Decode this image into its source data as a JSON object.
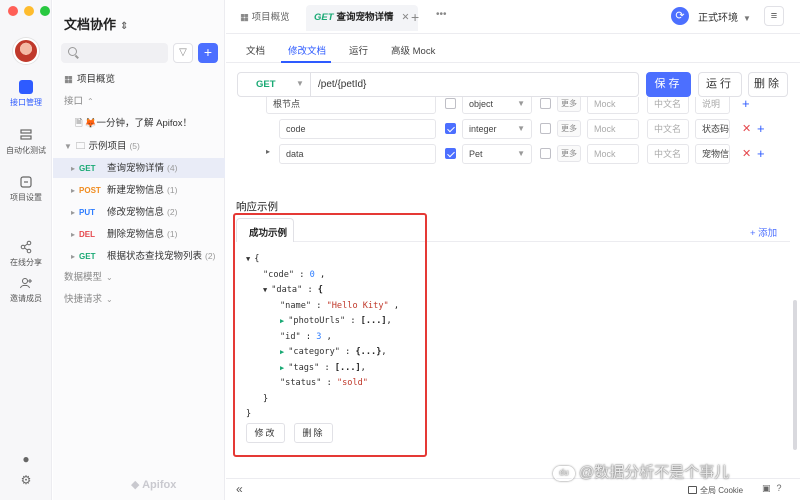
{
  "app": {
    "brand": "Apifox",
    "project_name": "文档协作"
  },
  "rail": {
    "items": [
      {
        "label": "接口管理",
        "active": true,
        "icon": "api-icon"
      },
      {
        "label": "自动化测试",
        "active": false,
        "icon": "automation-icon"
      },
      {
        "label": "项目设置",
        "active": false,
        "icon": "settings-icon"
      },
      {
        "label": "在线分享",
        "active": false,
        "icon": "share-icon"
      },
      {
        "label": "邀请成员",
        "active": false,
        "icon": "invite-icon"
      }
    ]
  },
  "sidebar": {
    "overview": "项目概览",
    "section_api": "接口",
    "intro_doc": "🦊一分钟，了解 Apifox！",
    "folder": {
      "label": "示例项目",
      "count": "(5)"
    },
    "apis": [
      {
        "method": "GET",
        "name": "查询宠物详情",
        "count": "(4)",
        "active": true
      },
      {
        "method": "POST",
        "name": "新建宠物信息",
        "count": "(1)",
        "active": false
      },
      {
        "method": "PUT",
        "name": "修改宠物信息",
        "count": "(2)",
        "active": false
      },
      {
        "method": "DEL",
        "name": "删除宠物信息",
        "count": "(1)",
        "active": false
      },
      {
        "method": "GET",
        "name": "根据状态查找宠物列表",
        "count": "(2)",
        "active": false
      }
    ],
    "section_models": "数据模型",
    "section_quick": "快捷请求"
  },
  "topbar": {
    "tab_overview": "项目概览",
    "tab_active_method": "GET",
    "tab_active_name": "查询宠物详情",
    "environment": "正式环境"
  },
  "subtabs": [
    "文档",
    "修改文档",
    "运行",
    "高级 Mock"
  ],
  "request": {
    "method": "GET",
    "path": "/pet/{petId}",
    "save": "保存",
    "run": "运行",
    "delete": "删除"
  },
  "schema_rows": [
    {
      "name": "根节点",
      "checked": false,
      "type": "object",
      "more": "更多",
      "mock": "Mock",
      "cn": "中文名",
      "desc": "说明",
      "has_x": false
    },
    {
      "name": "code",
      "checked": true,
      "type": "integer",
      "more": "更多",
      "mock": "Mock",
      "cn": "中文名",
      "desc": "状态码",
      "has_x": true
    },
    {
      "name": "data",
      "checked": true,
      "type": "Pet",
      "more": "更多",
      "mock": "Mock",
      "cn": "中文名",
      "desc": "宠物信",
      "has_x": true
    }
  ],
  "response": {
    "title": "响应示例",
    "tab": "成功示例",
    "add": "+ 添加",
    "edit": "修改",
    "delete": "删除",
    "json_lines": [
      {
        "indent": 0,
        "tri": "open",
        "text": "{"
      },
      {
        "indent": 1,
        "key": "\"code\"",
        "sep": " : ",
        "val": "0",
        "vtype": "num",
        "tail": " ,"
      },
      {
        "indent": 1,
        "tri": "open",
        "key": "\"data\"",
        "sep": " : ",
        "val": "{",
        "vtype": "plain",
        "tail": ""
      },
      {
        "indent": 2,
        "key": "\"name\"",
        "sep": " : ",
        "val": "\"Hello Kity\"",
        "vtype": "str",
        "tail": " ,"
      },
      {
        "indent": 2,
        "tri": "closed",
        "key": "\"photoUrls\"",
        "sep": " : ",
        "val": "[...]",
        "vtype": "plain",
        "tail": ","
      },
      {
        "indent": 2,
        "key": "\"id\"",
        "sep": " : ",
        "val": "3",
        "vtype": "num",
        "tail": " ,"
      },
      {
        "indent": 2,
        "tri": "closed",
        "key": "\"category\"",
        "sep": " : ",
        "val": "{...}",
        "vtype": "plain",
        "tail": ","
      },
      {
        "indent": 2,
        "tri": "closed",
        "key": "\"tags\"",
        "sep": " : ",
        "val": "[...]",
        "vtype": "plain",
        "tail": ","
      },
      {
        "indent": 2,
        "key": "\"status\"",
        "sep": " : ",
        "val": "\"sold\"",
        "vtype": "str",
        "tail": ""
      },
      {
        "indent": 1,
        "text": "}"
      },
      {
        "indent": 0,
        "text": "}"
      }
    ]
  },
  "footer": {
    "cookie": "全局 Cookie"
  },
  "watermark": {
    "badge": "du",
    "text": "@数据分析不是个事儿"
  },
  "colors": {
    "accent": "#4c6fff",
    "get": "#19a974",
    "post": "#f08c1f",
    "put": "#2e7dff",
    "delete": "#e5484d",
    "highlight": "#e53935"
  }
}
